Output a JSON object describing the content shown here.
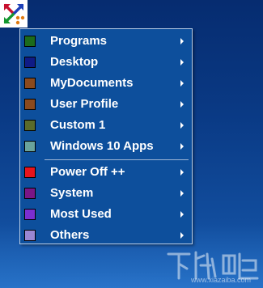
{
  "menu": {
    "items": [
      {
        "label": "Programs",
        "color": "#1c6b1c"
      },
      {
        "label": "Desktop",
        "color": "#0f1b86"
      },
      {
        "label": "MyDocuments",
        "color": "#8a4a1e"
      },
      {
        "label": "User Profile",
        "color": "#8a4a1e"
      },
      {
        "label": "Custom 1",
        "color": "#5a6b2a"
      },
      {
        "label": "Windows 10 Apps",
        "color": "#6aa39b"
      },
      {
        "label": "Power Off ++",
        "color": "#e8141c"
      },
      {
        "label": "System",
        "color": "#7a1686"
      },
      {
        "label": "Most Used",
        "color": "#7b2fd0"
      },
      {
        "label": "Others",
        "color": "#9a86d2"
      }
    ]
  },
  "watermark": {
    "text": "www.xiazaiba.com"
  }
}
